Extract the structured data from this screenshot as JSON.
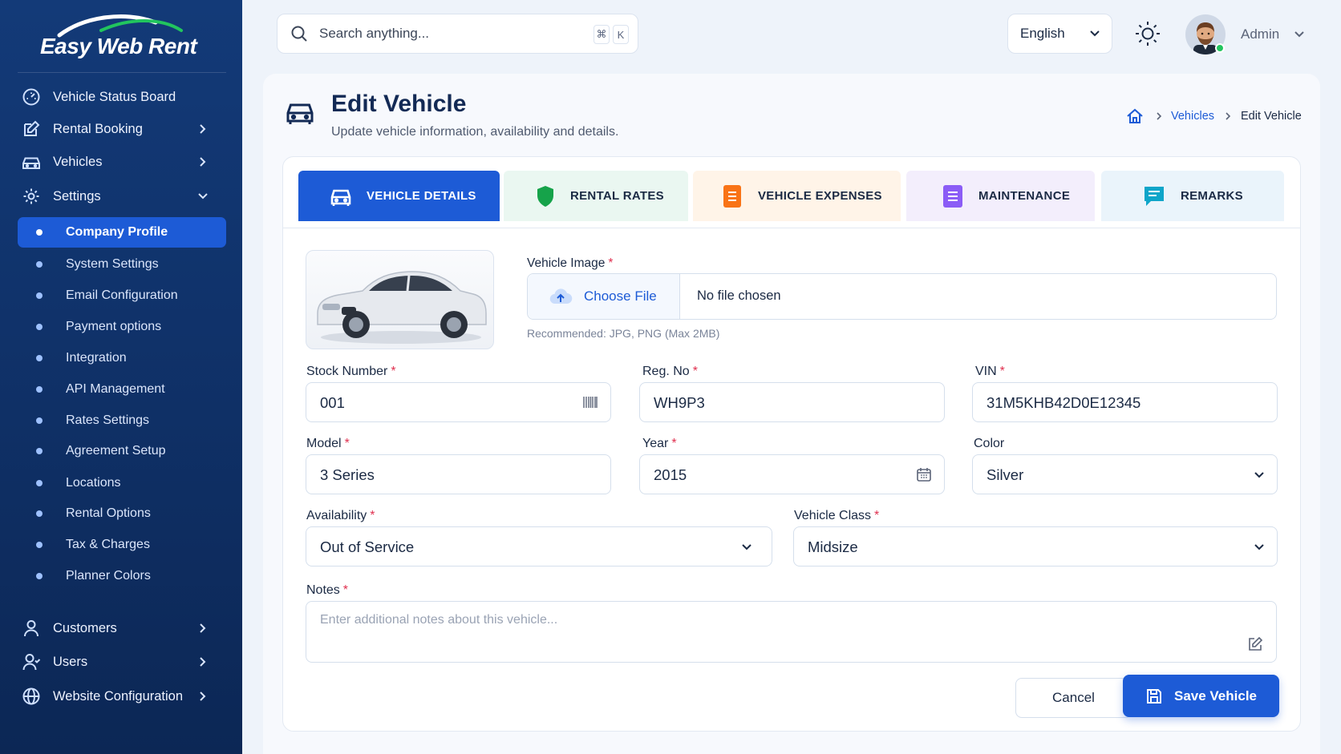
{
  "brand": {
    "name": "Easy Web Rent"
  },
  "sidebar": {
    "nav": [
      {
        "label": "Vehicle Status Board",
        "icon": "speedometer-icon"
      },
      {
        "label": "Rental Booking",
        "icon": "edit-icon"
      },
      {
        "label": "Vehicles",
        "icon": "car-icon"
      },
      {
        "label": "Settings",
        "icon": "gear-icon"
      }
    ],
    "settings_items": [
      "Company Profile",
      "System Settings",
      "Email Configuration",
      "Payment options",
      "Integration",
      "API Management",
      "Rates Settings",
      "Agreement Setup",
      "Locations",
      "Rental Options",
      "Tax & Charges",
      "Planner Colors"
    ],
    "active_settings_item": "Company Profile",
    "bottom_nav": [
      {
        "label": "Customers",
        "icon": "user-icon"
      },
      {
        "label": "Users",
        "icon": "users-icon"
      },
      {
        "label": "Website Configuration",
        "icon": "globe-icon"
      }
    ]
  },
  "topbar": {
    "search_placeholder": "Search anything...",
    "shortcut_mod": "⌘",
    "shortcut_key": "K",
    "language": "English",
    "user_name": "Admin"
  },
  "page": {
    "title": "Edit Vehicle",
    "subtitle": "Update vehicle information, availability and details.",
    "breadcrumb": {
      "link": "Vehicles",
      "current": "Edit Vehicle"
    }
  },
  "tabs": [
    {
      "label": "VEHICLE DETAILS",
      "active": true
    },
    {
      "label": "RENTAL RATES",
      "active": false
    },
    {
      "label": "VEHICLE EXPENSES",
      "active": false
    },
    {
      "label": "MAINTENANCE",
      "active": false
    },
    {
      "label": "REMARKS",
      "active": false
    }
  ],
  "form": {
    "vehicle_image": {
      "label": "Vehicle Image",
      "choose_label": "Choose File",
      "file_status": "No file chosen",
      "hint": "Recommended: JPG, PNG (Max 2MB)"
    },
    "stock_number": {
      "label": "Stock Number",
      "value": "001"
    },
    "reg_no": {
      "label": "Reg. No",
      "value": "WH9P3"
    },
    "vin": {
      "label": "VIN",
      "value": "31M5KHB42D0E12345"
    },
    "model": {
      "label": "Model",
      "value": "3 Series"
    },
    "year": {
      "label": "Year",
      "value": "2015"
    },
    "color": {
      "label": "Color",
      "value": "Silver"
    },
    "availability": {
      "label": "Availability",
      "value": "Out of Service"
    },
    "vehicle_class": {
      "label": "Vehicle Class",
      "value": "Midsize"
    },
    "notes": {
      "label": "Notes",
      "placeholder": "Enter additional notes about this vehicle..."
    },
    "required_mark": "*"
  },
  "actions": {
    "cancel": "Cancel",
    "save": "Save Vehicle"
  },
  "colors": {
    "sidebar": "#133a78",
    "accent": "#1d5bd6",
    "required": "#e0304f"
  }
}
